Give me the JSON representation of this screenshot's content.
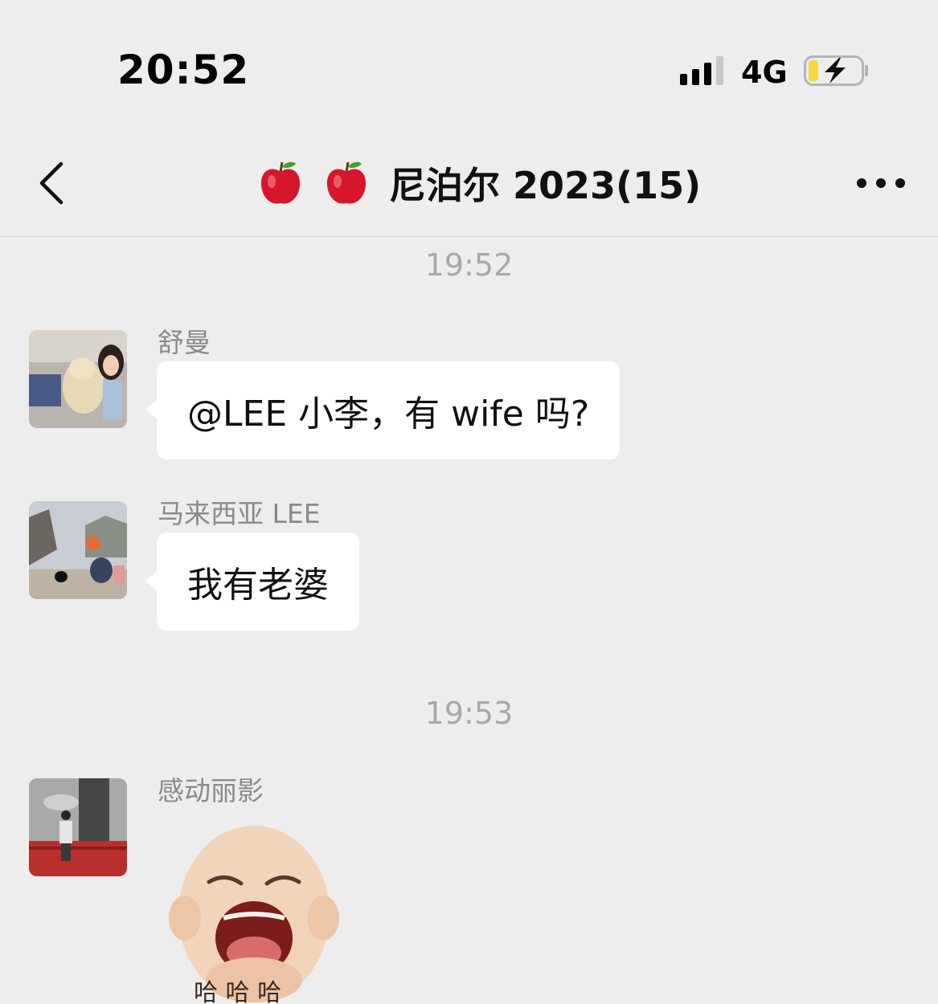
{
  "status_bar": {
    "time": "20:52",
    "network": "4G",
    "battery_icon": "battery-charging-icon"
  },
  "nav": {
    "title": "尼泊尔 2023(15)",
    "title_emoji": "apple-icon"
  },
  "messages": [
    {
      "timestamp": "19:52"
    },
    {
      "sender": "舒曼",
      "text": "@LEE 小李，有 wife 吗?"
    },
    {
      "sender": "马来西亚 LEE",
      "text": "我有老婆"
    },
    {
      "timestamp": "19:53"
    },
    {
      "sender": "感动丽影",
      "sticker_text": "哈 哈 哈"
    }
  ],
  "colors": {
    "background": "#ededed",
    "bubble": "#ffffff",
    "battery_level": "#f5d742"
  }
}
